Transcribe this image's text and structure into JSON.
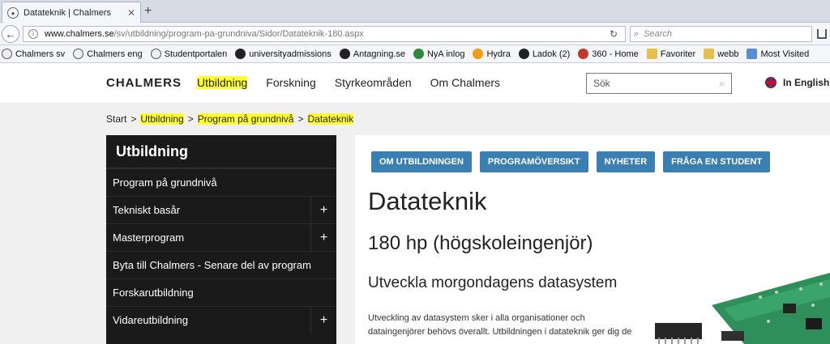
{
  "browser": {
    "tab_title": "Datateknik | Chalmers",
    "url_host": "www.chalmers.se",
    "url_path": "/sv/utbildning/program-pa-grundniva/Sidor/Datateknik-180.aspx",
    "search_placeholder": "Search",
    "bookmarks": [
      {
        "label": "Chalmers sv",
        "icon": "seal-icon"
      },
      {
        "label": "Chalmers eng",
        "icon": "seal-icon"
      },
      {
        "label": "Studentportalen",
        "icon": "seal-icon"
      },
      {
        "label": "universityadmissions",
        "icon": "circle-icon"
      },
      {
        "label": "Antagning.se",
        "icon": "circle-icon"
      },
      {
        "label": "NyA inlog",
        "icon": "circle-icon"
      },
      {
        "label": "Hydra",
        "icon": "sun-icon"
      },
      {
        "label": "Ladok (2)",
        "icon": "circle-icon"
      },
      {
        "label": "360 - Home",
        "icon": "circle-icon"
      },
      {
        "label": "Favoriter",
        "icon": "folder-icon"
      },
      {
        "label": "webb",
        "icon": "folder-icon"
      },
      {
        "label": "Most Visited",
        "icon": "page-icon"
      }
    ]
  },
  "site": {
    "logo": "CHALMERS",
    "nav": [
      "Utbildning",
      "Forskning",
      "Styrkeområden",
      "Om Chalmers"
    ],
    "search_placeholder": "Sök",
    "lang": "In English",
    "breadcrumb": [
      "Start",
      "Utbildning",
      "Program på grundnivå",
      "Datateknik"
    ],
    "sidebar": {
      "heading": "Utbildning",
      "items": [
        {
          "label": "Program på grundnivå",
          "expandable": false
        },
        {
          "label": "Tekniskt basår",
          "expandable": true
        },
        {
          "label": "Masterprogram",
          "expandable": true
        },
        {
          "label": "Byta till Chalmers - Senare del av program",
          "expandable": false
        },
        {
          "label": "Forskarutbildning",
          "expandable": false
        },
        {
          "label": "Vidareutbildning",
          "expandable": true
        }
      ]
    },
    "main": {
      "buttons": [
        "OM UTBILDNINGEN",
        "PROGRAMÖVERSIKT",
        "NYHETER",
        "FRÅGA EN STUDENT"
      ],
      "title": "Datateknik",
      "subtitle": "180 hp (högskoleingenjör)",
      "lead": "Utveckla morgondagens datasystem",
      "paragraph_line1": "Utveckling av datasystem sker i alla organisationer och",
      "paragraph_line2": "dataingenjörer behövs överallt. Utbildningen i datateknik ger dig de"
    }
  },
  "colors": {
    "highlight": "#ffff33",
    "button_blue": "#3a7fb1",
    "sidebar_bg": "#1a1a1a"
  }
}
